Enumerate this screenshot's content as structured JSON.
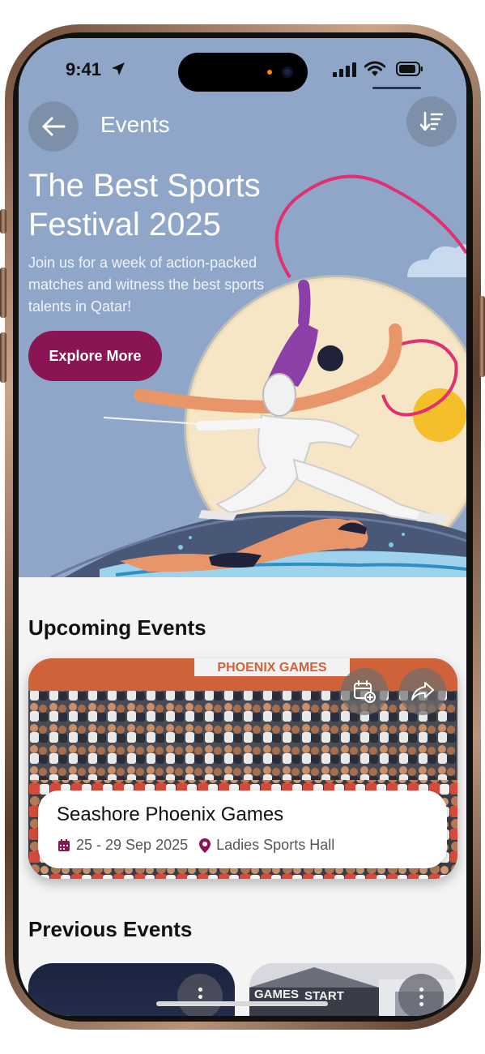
{
  "status_bar": {
    "time": "9:41"
  },
  "nav": {
    "title": "Events"
  },
  "hero": {
    "title": "The Best Sports Festival 2025",
    "subtitle": "Join us for a week of action-packed matches and witness the best  sports talents in Qatar!",
    "cta_label": "Explore More"
  },
  "upcoming": {
    "heading": "Upcoming Events",
    "event": {
      "banner_text": "PHOENIX GAMES",
      "name": "Seashore Phoenix Games",
      "dates": "25 - 29 Sep 2025",
      "location": "Ladies Sports Hall"
    }
  },
  "previous": {
    "heading": "Previous Events",
    "card_2_banner": "GAMES",
    "card_2_sign": "START"
  },
  "colors": {
    "accent": "#8b1553",
    "hero_bg": "#8fa6c8",
    "page_bg": "#f4f4f4"
  },
  "icons": {
    "back": "arrow-left-icon",
    "sort": "sort-icon",
    "calendar_add": "calendar-add-icon",
    "share": "share-icon",
    "calendar": "calendar-icon",
    "location": "location-pin-icon",
    "more": "more-vertical-icon"
  }
}
